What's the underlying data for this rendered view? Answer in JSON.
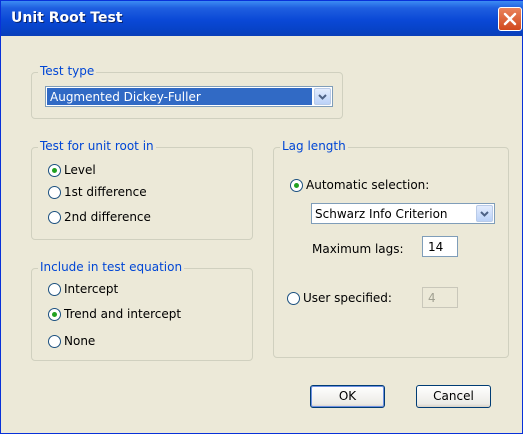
{
  "window": {
    "title": "Unit Root Test"
  },
  "test_type": {
    "legend": "Test type",
    "selected": "Augmented Dickey-Fuller"
  },
  "unit_root_in": {
    "legend": "Test for unit root in",
    "options": [
      {
        "label": "Level",
        "checked": true
      },
      {
        "label": "1st difference",
        "checked": false
      },
      {
        "label": "2nd difference",
        "checked": false
      }
    ]
  },
  "include": {
    "legend": "Include in test equation",
    "options": [
      {
        "label": "Intercept",
        "checked": false
      },
      {
        "label": "Trend and intercept",
        "checked": true
      },
      {
        "label": "None",
        "checked": false
      }
    ]
  },
  "lag_length": {
    "legend": "Lag length",
    "automatic_label": "Automatic selection:",
    "automatic_checked": true,
    "criterion": "Schwarz Info Criterion",
    "max_lags_label": "Maximum lags:",
    "max_lags_value": "14",
    "user_label": "User specified:",
    "user_checked": false,
    "user_value": "4"
  },
  "buttons": {
    "ok": "OK",
    "cancel": "Cancel"
  },
  "colors": {
    "accent": "#0046d5",
    "titlebar": "#0a48d6",
    "radio_check": "#21a121"
  }
}
